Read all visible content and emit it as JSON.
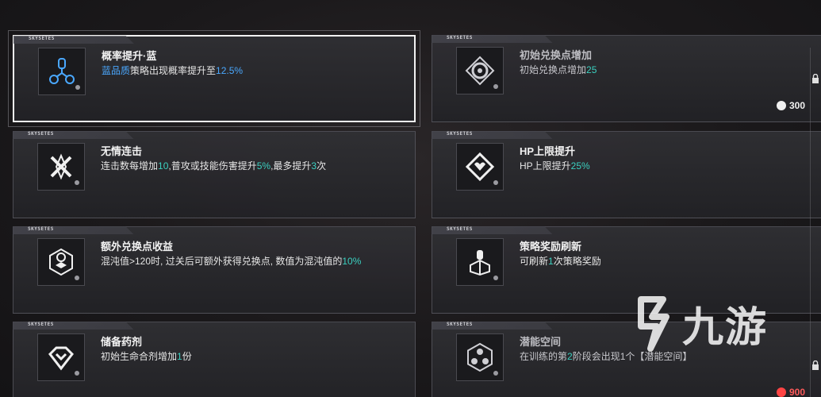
{
  "brand_tag": "SKYSETES",
  "watermark": {
    "text": "九游"
  },
  "left_cards": [
    {
      "title": "概率提升·蓝",
      "desc": [
        {
          "t": "蓝品质",
          "c": "blue"
        },
        {
          "t": "策略出现概率提升至",
          "c": ""
        },
        {
          "t": "12.5%",
          "c": "blue"
        }
      ],
      "icon": "trinity-node-icon",
      "selected": true
    },
    {
      "title": "无情连击",
      "desc": [
        {
          "t": "连击数每增加",
          "c": ""
        },
        {
          "t": "10",
          "c": "teal"
        },
        {
          "t": ",普攻或技能伤害提升",
          "c": ""
        },
        {
          "t": "5%",
          "c": "teal"
        },
        {
          "t": ",最多提升",
          "c": ""
        },
        {
          "t": "3",
          "c": "teal"
        },
        {
          "t": "次",
          "c": ""
        }
      ],
      "icon": "crossed-blades-icon"
    },
    {
      "title": "额外兑换点收益",
      "desc": [
        {
          "t": "混沌值>120时, 过关后可额外获得兑换点, 数值为混沌值的",
          "c": ""
        },
        {
          "t": "10%",
          "c": "teal"
        }
      ],
      "icon": "exchange-cube-icon"
    },
    {
      "title": "储备药剂",
      "desc": [
        {
          "t": "初始生命合剂增加",
          "c": ""
        },
        {
          "t": "1",
          "c": "teal"
        },
        {
          "t": "份",
          "c": ""
        }
      ],
      "icon": "potion-diamond-icon"
    }
  ],
  "right_cards": [
    {
      "title": "初始兑换点增加",
      "desc": [
        {
          "t": "初始兑换点增加",
          "c": ""
        },
        {
          "t": "25",
          "c": "teal"
        }
      ],
      "icon": "exchange-coin-icon",
      "locked": true,
      "cost": "300",
      "cost_color": "white"
    },
    {
      "title": "HP上限提升",
      "desc": [
        {
          "t": "HP上限提升",
          "c": ""
        },
        {
          "t": "25%",
          "c": "teal"
        }
      ],
      "icon": "heart-diamond-icon"
    },
    {
      "title": "策略奖励刷新",
      "desc": [
        {
          "t": "可刷新",
          "c": ""
        },
        {
          "t": "1",
          "c": "teal"
        },
        {
          "t": "次策略奖励",
          "c": ""
        }
      ],
      "icon": "refresh-node-icon"
    },
    {
      "title": "潜能空间",
      "desc": [
        {
          "t": "在训练的第",
          "c": ""
        },
        {
          "t": "2",
          "c": "teal"
        },
        {
          "t": "阶段会出现1个【潜能空间】",
          "c": ""
        }
      ],
      "icon": "hex-cluster-icon",
      "locked": true,
      "cost": "900",
      "cost_color": "red"
    }
  ]
}
